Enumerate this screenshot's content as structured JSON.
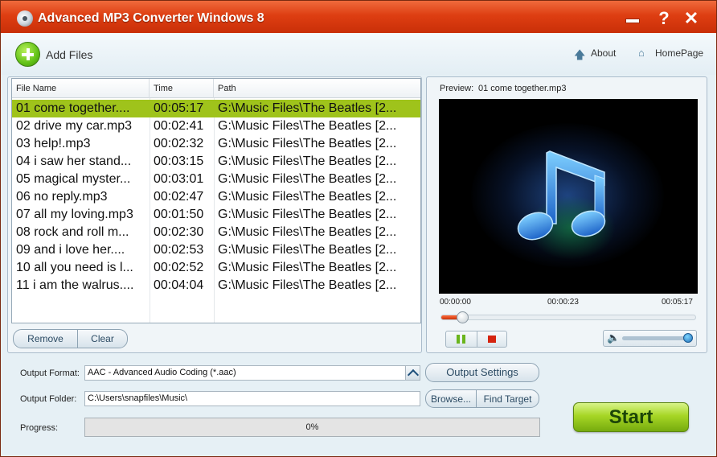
{
  "window": {
    "title": "Advanced MP3 Converter Windows 8",
    "help_glyph": "?",
    "close_glyph": "✕"
  },
  "toolbar": {
    "add_files": "Add Files",
    "about": "About",
    "homepage": "HomePage"
  },
  "file_list": {
    "columns": [
      "File Name",
      "Time",
      "Path"
    ],
    "rows": [
      {
        "name": "01 come together....",
        "time": "00:05:17",
        "path": "G:\\Music Files\\The Beatles [2...",
        "selected": true
      },
      {
        "name": "02 drive my car.mp3",
        "time": "00:02:41",
        "path": "G:\\Music Files\\The Beatles [2..."
      },
      {
        "name": "03 help!.mp3",
        "time": "00:02:32",
        "path": "G:\\Music Files\\The Beatles [2..."
      },
      {
        "name": "04 i saw her stand...",
        "time": "00:03:15",
        "path": "G:\\Music Files\\The Beatles [2..."
      },
      {
        "name": "05 magical myster...",
        "time": "00:03:01",
        "path": "G:\\Music Files\\The Beatles [2..."
      },
      {
        "name": "06 no reply.mp3",
        "time": "00:02:47",
        "path": "G:\\Music Files\\The Beatles [2..."
      },
      {
        "name": "07 all my loving.mp3",
        "time": "00:01:50",
        "path": "G:\\Music Files\\The Beatles [2..."
      },
      {
        "name": "08 rock and roll m...",
        "time": "00:02:30",
        "path": "G:\\Music Files\\The Beatles [2..."
      },
      {
        "name": "09 and i love her....",
        "time": "00:02:53",
        "path": "G:\\Music Files\\The Beatles [2..."
      },
      {
        "name": "10 all you need is l...",
        "time": "00:02:52",
        "path": "G:\\Music Files\\The Beatles [2..."
      },
      {
        "name": "11 i am the walrus....",
        "time": "00:04:04",
        "path": "G:\\Music Files\\The Beatles [2..."
      }
    ],
    "remove": "Remove",
    "clear": "Clear"
  },
  "preview": {
    "label": "Preview:",
    "file": "01 come together.mp3",
    "time_start": "00:00:00",
    "time_current": "00:00:23",
    "time_end": "00:05:17",
    "seek_fraction": 0.07,
    "volume_fraction": 0.9
  },
  "output": {
    "format_label": "Output Format:",
    "format_value": "AAC - Advanced Audio Coding (*.aac)",
    "settings_button": "Output Settings",
    "folder_label": "Output Folder:",
    "folder_value": "C:\\Users\\snapfiles\\Music\\",
    "browse_button": "Browse...",
    "find_target_button": "Find Target",
    "progress_label": "Progress:",
    "progress_text": "0%",
    "progress_value": 0,
    "start_button": "Start"
  },
  "icons": {
    "app": "disc-icon",
    "add": "add-circle-icon",
    "about": "up-arrow-icon",
    "home": "home-icon",
    "pause": "pause-icon",
    "stop": "stop-icon",
    "volume": "speaker-icon",
    "preview_art": "music-note-icon"
  },
  "colors": {
    "title_bar": "#de3e12",
    "selected_row": "#9fc31b",
    "start_button": "#a6d625"
  }
}
